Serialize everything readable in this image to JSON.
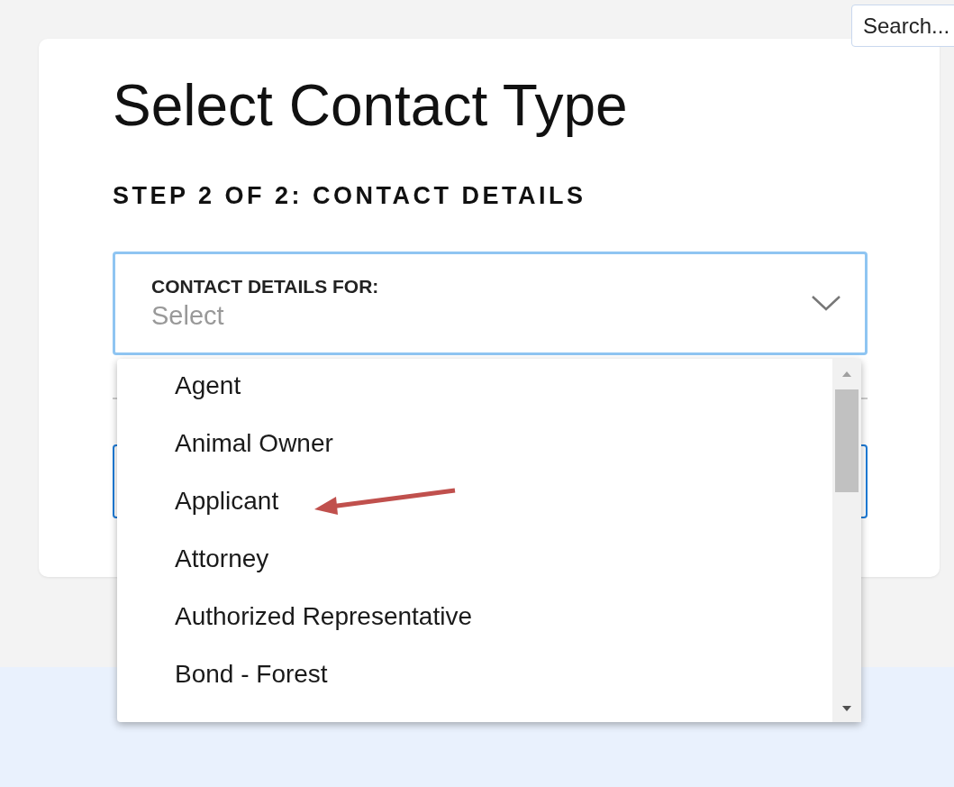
{
  "search": {
    "placeholder": "Search..."
  },
  "title": "Select Contact Type",
  "step": "STEP 2 OF 2: CONTACT DETAILS",
  "select": {
    "label": "CONTACT DETAILS FOR:",
    "placeholder": "Select",
    "expanded": true
  },
  "options": [
    {
      "label": "Agent",
      "selected": false
    },
    {
      "label": "Animal Owner",
      "selected": false
    },
    {
      "label": "Applicant",
      "selected": false
    },
    {
      "label": "Attorney",
      "selected": false
    },
    {
      "label": "Authorized Representative",
      "selected": false
    },
    {
      "label": "Bond - Forest",
      "selected": false
    }
  ]
}
